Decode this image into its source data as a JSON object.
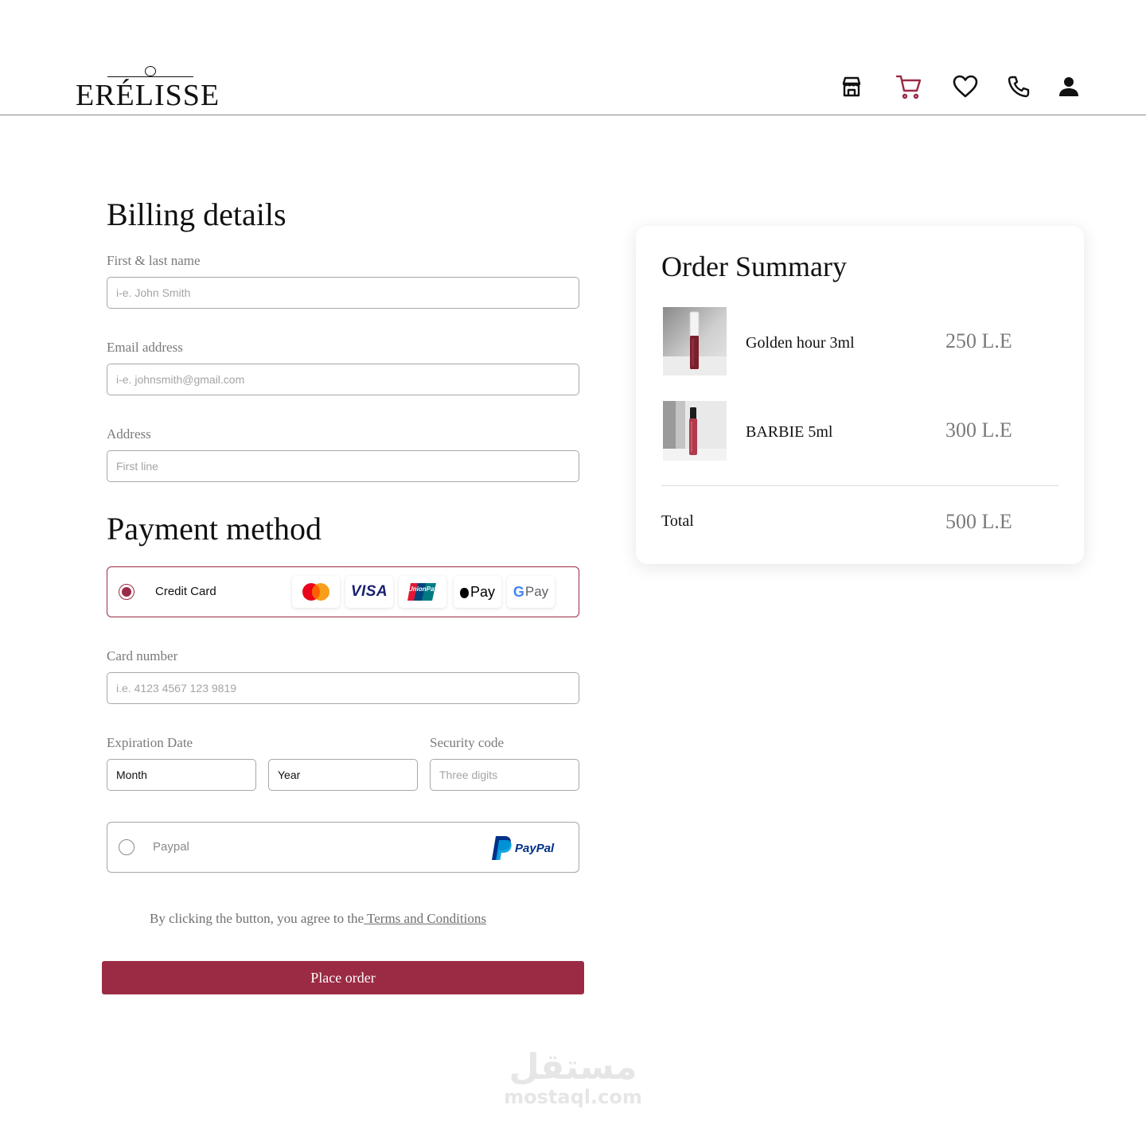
{
  "brand": {
    "name": "ERÉLISSE"
  },
  "nav": {
    "icons": [
      "store-icon",
      "cart-icon",
      "heart-icon",
      "phone-icon",
      "user-icon"
    ],
    "active": "cart-icon"
  },
  "billing": {
    "title": "Billing details",
    "name": {
      "label": "First & last name",
      "placeholder": "i-e. John Smith"
    },
    "email": {
      "label": "Email address",
      "placeholder": "i-e. johnsmith@gmail.com"
    },
    "address": {
      "label": "Address",
      "placeholder": "First line"
    }
  },
  "payment": {
    "title": "Payment method",
    "credit_card": {
      "label": "Credit Card",
      "selected": true,
      "logos": [
        "mastercard",
        "VISA",
        "UnionPay",
        "Pay",
        "Pay"
      ]
    },
    "card_number": {
      "label": "Card number",
      "placeholder": "i.e. 4123 4567 123 9819"
    },
    "expiration": {
      "label": "Expiration Date",
      "month": "Month",
      "year": "Year"
    },
    "security": {
      "label": "Security code",
      "placeholder": "Three digits"
    },
    "paypal": {
      "label": "Paypal",
      "selected": false,
      "logo_text": "PayPal"
    }
  },
  "terms": {
    "text": "By clicking the button, you agree to the",
    "link": " Terms and Conditions"
  },
  "place_order": "Place order",
  "summary": {
    "title": "Order Summary",
    "items": [
      {
        "name": "Golden hour 3ml",
        "price": "250 L.E"
      },
      {
        "name": "BARBIE 5ml",
        "price": "300 L.E"
      }
    ],
    "total_label": "Total",
    "total_value": "500 L.E"
  },
  "watermark": {
    "arabic": "مستقل",
    "latin": "mostaql.com"
  },
  "colors": {
    "accent": "#9b2b45",
    "text": "#111111",
    "muted": "#7a7a7a",
    "border": "#a7a7a7"
  }
}
